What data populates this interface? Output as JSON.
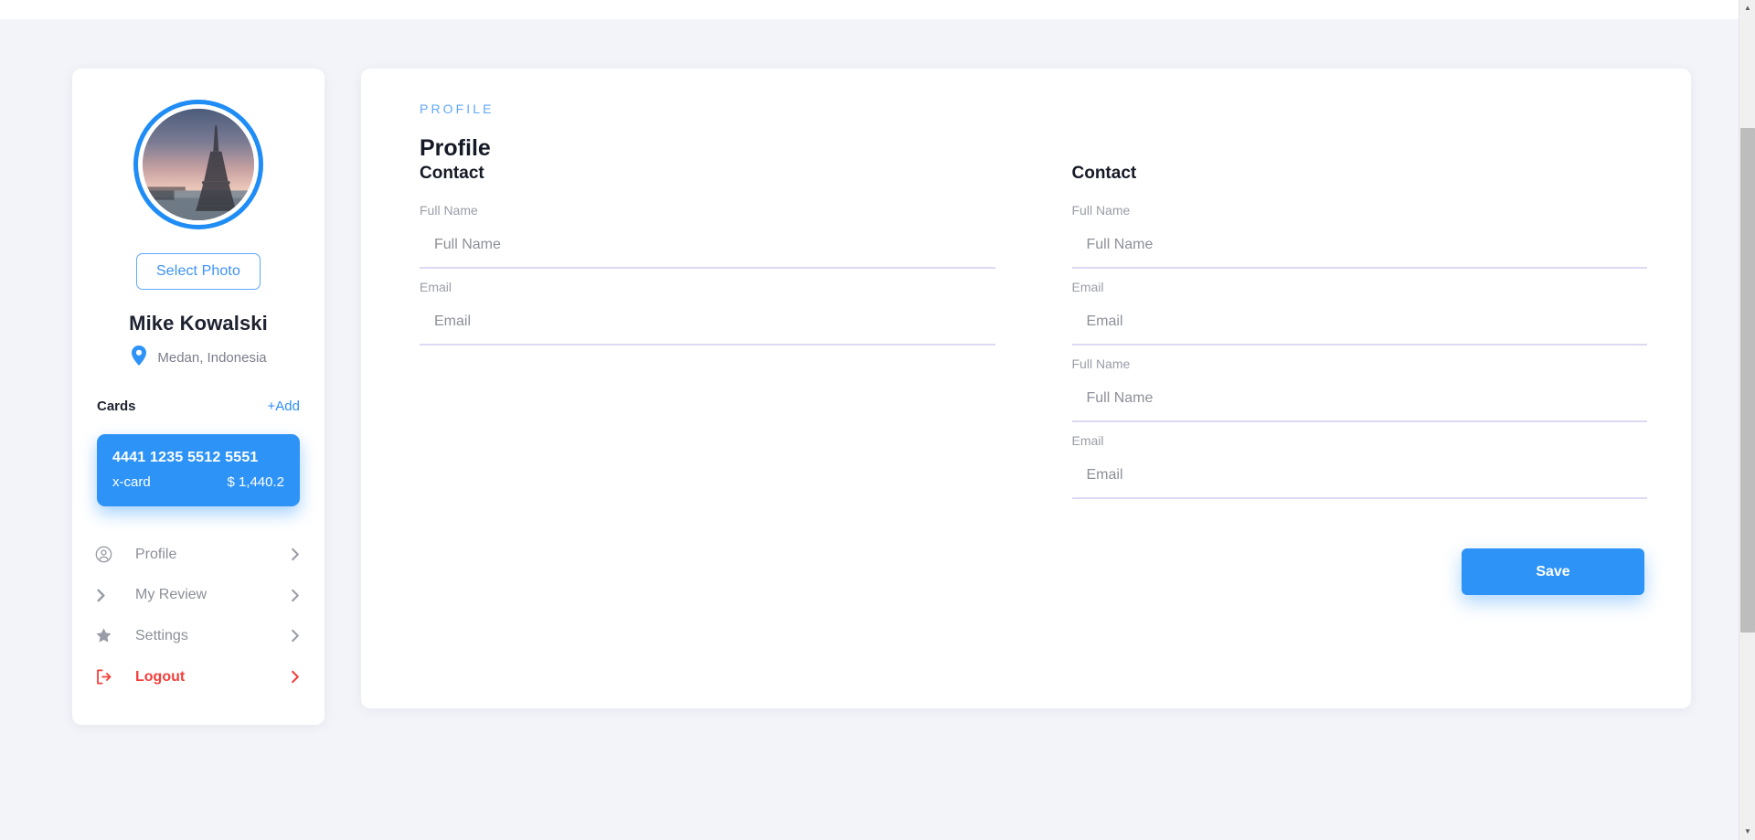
{
  "sidebar": {
    "avatar_alt": "eiffel-tower-photo",
    "select_photo_label": "Select Photo",
    "user_name": "Mike Kowalski",
    "location": "Medan, Indonesia",
    "cards_title": "Cards",
    "cards_add_label": "+Add",
    "card": {
      "number": "4441 1235 5512 5551",
      "name": "x-card",
      "balance": "$ 1,440.2"
    },
    "nav": [
      {
        "label": "Profile",
        "icon": "user-circle-icon",
        "chevron": "chevron-right-icon",
        "danger": false
      },
      {
        "label": "My Review",
        "icon": "chevron-right-icon",
        "chevron": "chevron-right-icon",
        "danger": false
      },
      {
        "label": "Settings",
        "icon": "star-icon",
        "chevron": "chevron-right-icon",
        "danger": false
      },
      {
        "label": "Logout",
        "icon": "logout-icon",
        "chevron": "chevron-right-icon",
        "danger": true
      }
    ]
  },
  "main": {
    "eyebrow": "PROFILE",
    "title": "Profile",
    "left_section_title": "Contact",
    "right_section_title": "Contact",
    "left_fields": [
      {
        "label": "Full Name",
        "placeholder": "Full Name",
        "value": ""
      },
      {
        "label": "Email",
        "placeholder": "Email",
        "value": ""
      }
    ],
    "right_fields": [
      {
        "label": "Full Name",
        "placeholder": "Full Name",
        "value": ""
      },
      {
        "label": "Email",
        "placeholder": "Email",
        "value": ""
      },
      {
        "label": "Full Name",
        "placeholder": "Full Name",
        "value": ""
      },
      {
        "label": "Email",
        "placeholder": "Email",
        "value": ""
      }
    ],
    "save_label": "Save"
  },
  "colors": {
    "accent_blue": "#2d93f7",
    "eyebrow_blue": "#5fa8f9",
    "danger_red": "#f2403c",
    "field_underline": "#ded9f3",
    "page_background": "#f3f4f9"
  },
  "scrollbar": {
    "up_arrow": "▲",
    "down_arrow": "▼"
  }
}
